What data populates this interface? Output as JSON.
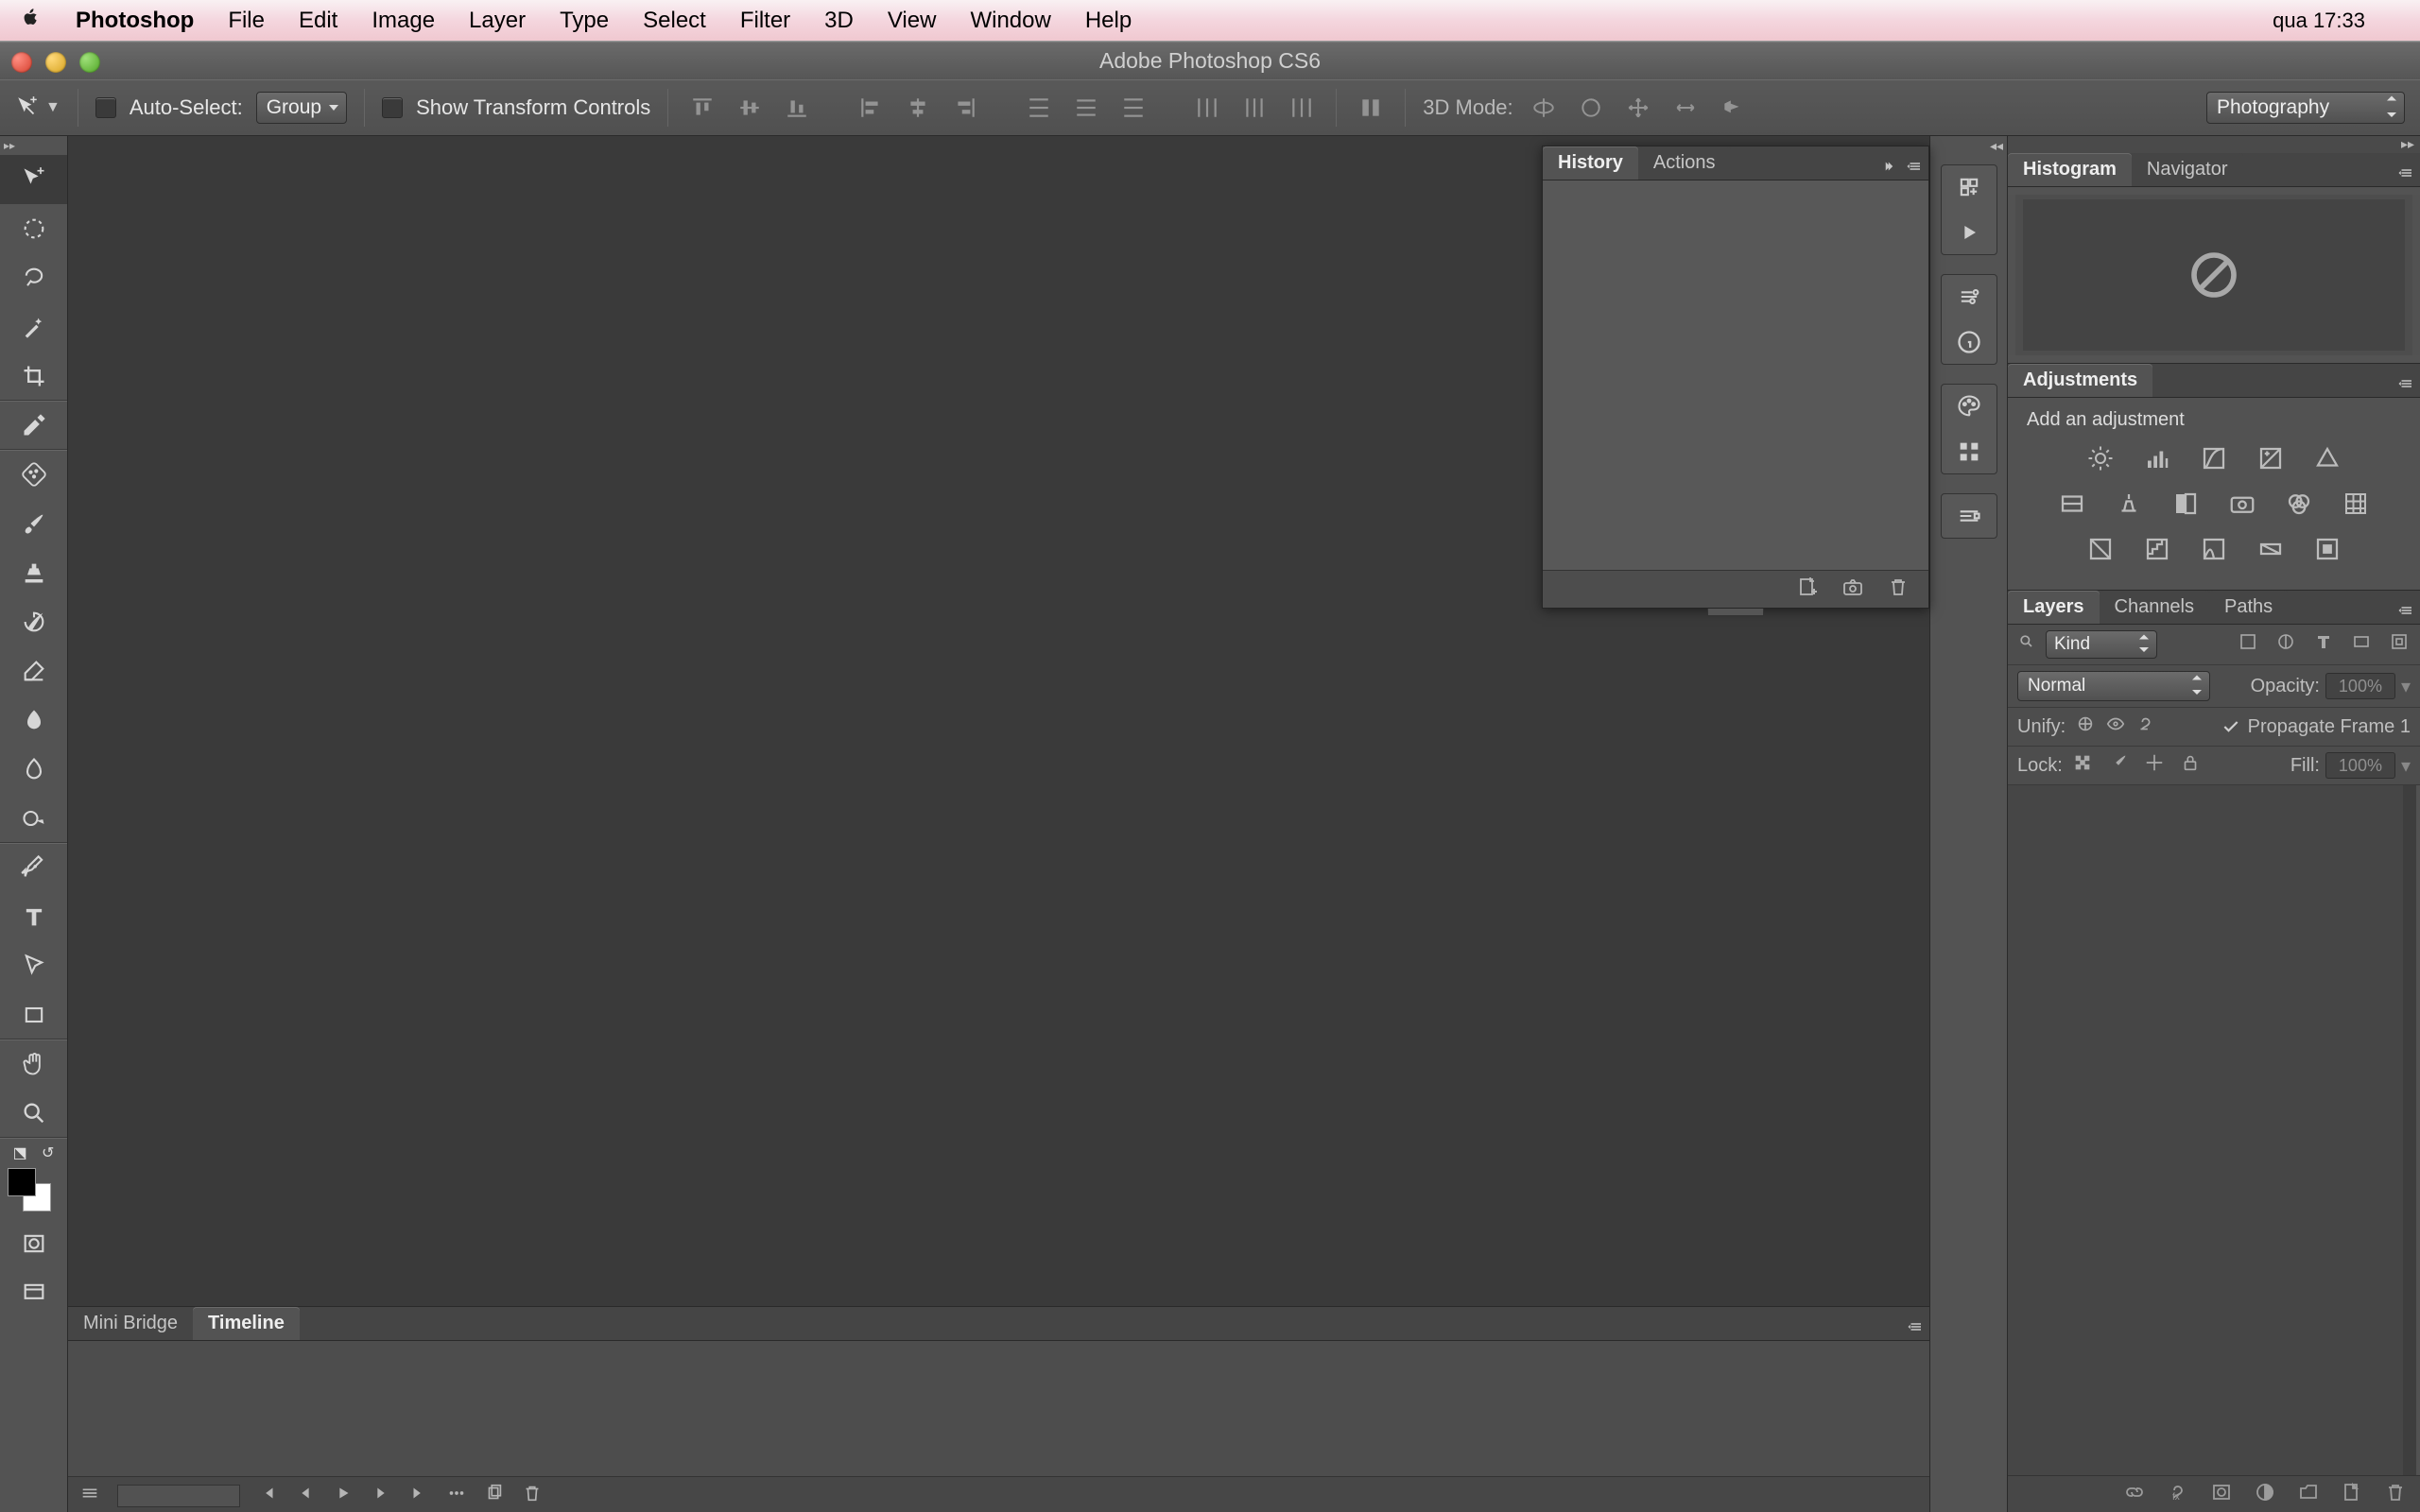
{
  "menubar": {
    "app": "Photoshop",
    "items": [
      "File",
      "Edit",
      "Image",
      "Layer",
      "Type",
      "Select",
      "Filter",
      "3D",
      "View",
      "Window",
      "Help"
    ],
    "clock": "qua 17:33"
  },
  "window": {
    "title": "Adobe Photoshop CS6"
  },
  "options": {
    "auto_select_label": "Auto-Select:",
    "auto_select_value": "Group",
    "show_transform_label": "Show Transform Controls",
    "mode3d_label": "3D Mode:"
  },
  "workspace_dropdown": "Photography",
  "history_panel": {
    "tabs": [
      "History",
      "Actions"
    ],
    "active": 0
  },
  "bottom_dock": {
    "tabs": [
      "Mini Bridge",
      "Timeline"
    ],
    "active": 1
  },
  "right": {
    "histogram_tabs": [
      "Histogram",
      "Navigator"
    ],
    "histogram_active": 0,
    "adjustments_tab": "Adjustments",
    "adjustments_hint": "Add an adjustment",
    "layers_tabs": [
      "Layers",
      "Channels",
      "Paths"
    ],
    "layers_active": 0,
    "kind_label": "Kind",
    "blend_mode": "Normal",
    "opacity_label": "Opacity:",
    "opacity_value": "100%",
    "unify_label": "Unify:",
    "propagate_label": "Propagate Frame 1",
    "lock_label": "Lock:",
    "fill_label": "Fill:",
    "fill_value": "100%"
  }
}
